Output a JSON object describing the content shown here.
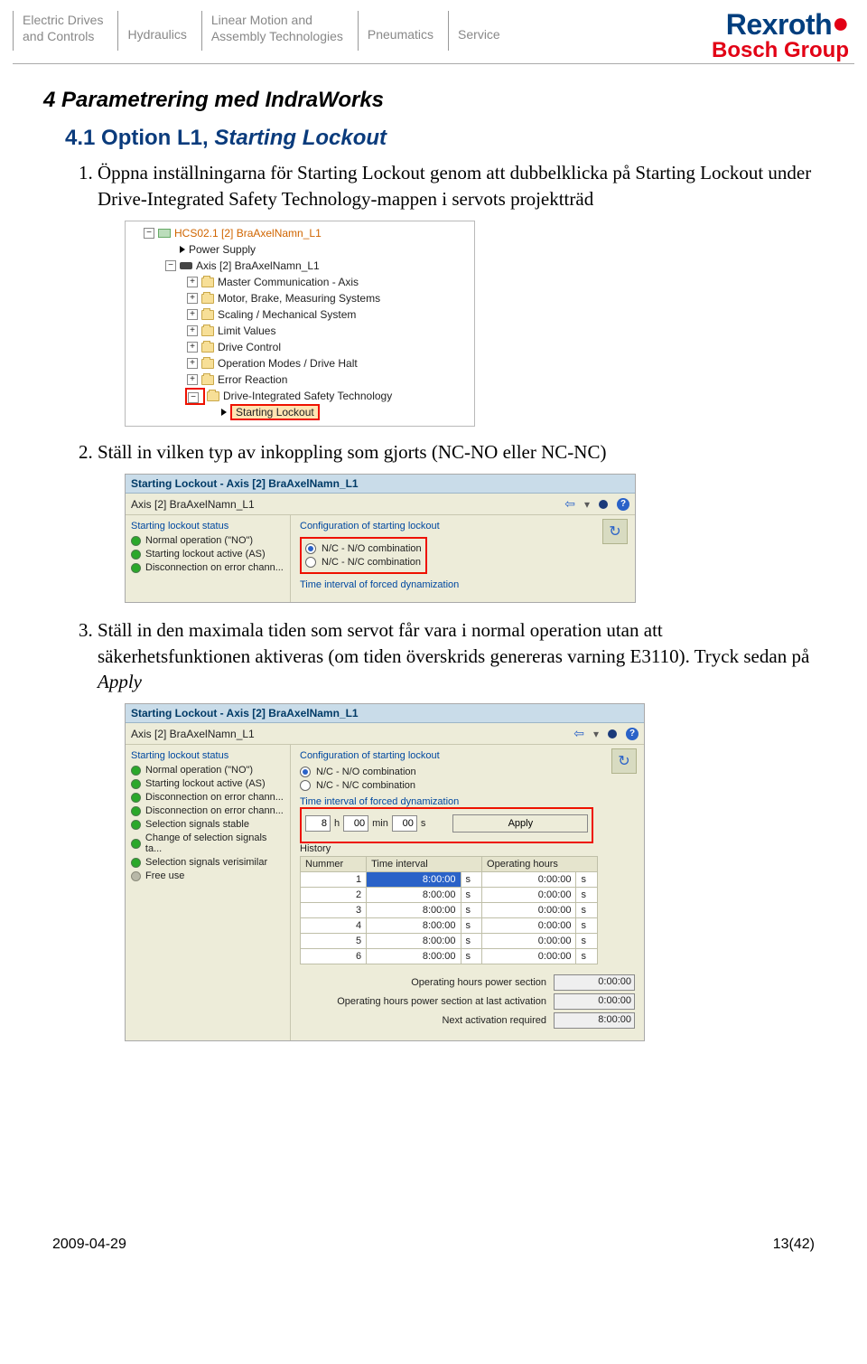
{
  "header": {
    "cells": [
      "Electric Drives\nand Controls",
      "Hydraulics",
      "Linear Motion and\nAssembly Technologies",
      "Pneumatics",
      "Service"
    ],
    "brand_top": "Rexroth",
    "brand_bottom": "Bosch Group"
  },
  "section_title": "4 Parametrering med IndraWorks",
  "subsection_prefix": "4.1 Option L1, ",
  "subsection_em": "Starting Lockout",
  "step1": "Öppna inställningarna för Starting Lockout genom att dubbelklicka på Starting Lockout under Drive-Integrated Safety Technology-mappen i servots projektträd",
  "step2": "Ställ in vilken typ av inkoppling som gjorts (NC-NO eller NC-NC)",
  "step3": "Ställ in den maximala tiden som servot får vara i normal operation utan att säkerhetsfunktionen aktiveras (om tiden överskrids genereras varning E3110). Tryck sedan på ",
  "step3_em": "Apply",
  "tree": {
    "root": "HCS02.1 [2] BraAxelNamn_L1",
    "power": "Power Supply",
    "axis": "Axis [2] BraAxelNamn_L1",
    "folders": [
      "Master Communication - Axis",
      "Motor, Brake, Measuring Systems",
      "Scaling / Mechanical System",
      "Limit Values",
      "Drive Control",
      "Operation Modes / Drive Halt",
      "Error Reaction",
      "Drive-Integrated Safety Technology"
    ],
    "selected": "Starting Lockout"
  },
  "cfgA": {
    "title": "Starting Lockout - Axis [2] BraAxelNamn_L1",
    "axis": "Axis [2] BraAxelNamn_L1",
    "left_title": "Starting lockout status",
    "left": [
      "Normal operation (\"NO\")",
      "Starting lockout active (AS)",
      "Disconnection on error chann..."
    ],
    "right_title": "Configuration of starting lockout",
    "r1": "N/C - N/O combination",
    "r2": "N/C - N/C combination",
    "cut": "Time interval of forced dynamization"
  },
  "cfgB": {
    "title": "Starting Lockout - Axis [2] BraAxelNamn_L1",
    "axis": "Axis [2] BraAxelNamn_L1",
    "left_title": "Starting lockout status",
    "left": [
      "Normal operation (\"NO\")",
      "Starting lockout active (AS)",
      "Disconnection on error chann...",
      "Disconnection on error chann...",
      "Selection signals stable",
      "Change of selection signals ta...",
      "Selection signals verisimilar",
      "Free use"
    ],
    "right_title": "Configuration of starting lockout",
    "r1": "N/C - N/O combination",
    "r2": "N/C - N/C combination",
    "time_title": "Time interval of forced dynamization",
    "h": "8",
    "m": "00",
    "s": "00",
    "hl": "h",
    "ml": "min",
    "sl": "s",
    "apply": "Apply",
    "hist_title": "History",
    "cols": [
      "Nummer",
      "Time interval",
      "Operating hours"
    ],
    "rows": [
      {
        "n": "1",
        "ti": "8:00:00",
        "u": "s",
        "oh": "0:00:00",
        "u2": "s",
        "sel": true
      },
      {
        "n": "2",
        "ti": "8:00:00",
        "u": "s",
        "oh": "0:00:00",
        "u2": "s"
      },
      {
        "n": "3",
        "ti": "8:00:00",
        "u": "s",
        "oh": "0:00:00",
        "u2": "s"
      },
      {
        "n": "4",
        "ti": "8:00:00",
        "u": "s",
        "oh": "0:00:00",
        "u2": "s"
      },
      {
        "n": "5",
        "ti": "8:00:00",
        "u": "s",
        "oh": "0:00:00",
        "u2": "s"
      },
      {
        "n": "6",
        "ti": "8:00:00",
        "u": "s",
        "oh": "0:00:00",
        "u2": "s"
      }
    ],
    "sum": [
      {
        "l": "Operating hours power section",
        "v": "0:00:00"
      },
      {
        "l": "Operating hours power section at last activation",
        "v": "0:00:00"
      },
      {
        "l": "Next activation required",
        "v": "8:00:00"
      }
    ]
  },
  "footer": {
    "date": "2009-04-29",
    "page": "13(42)"
  }
}
